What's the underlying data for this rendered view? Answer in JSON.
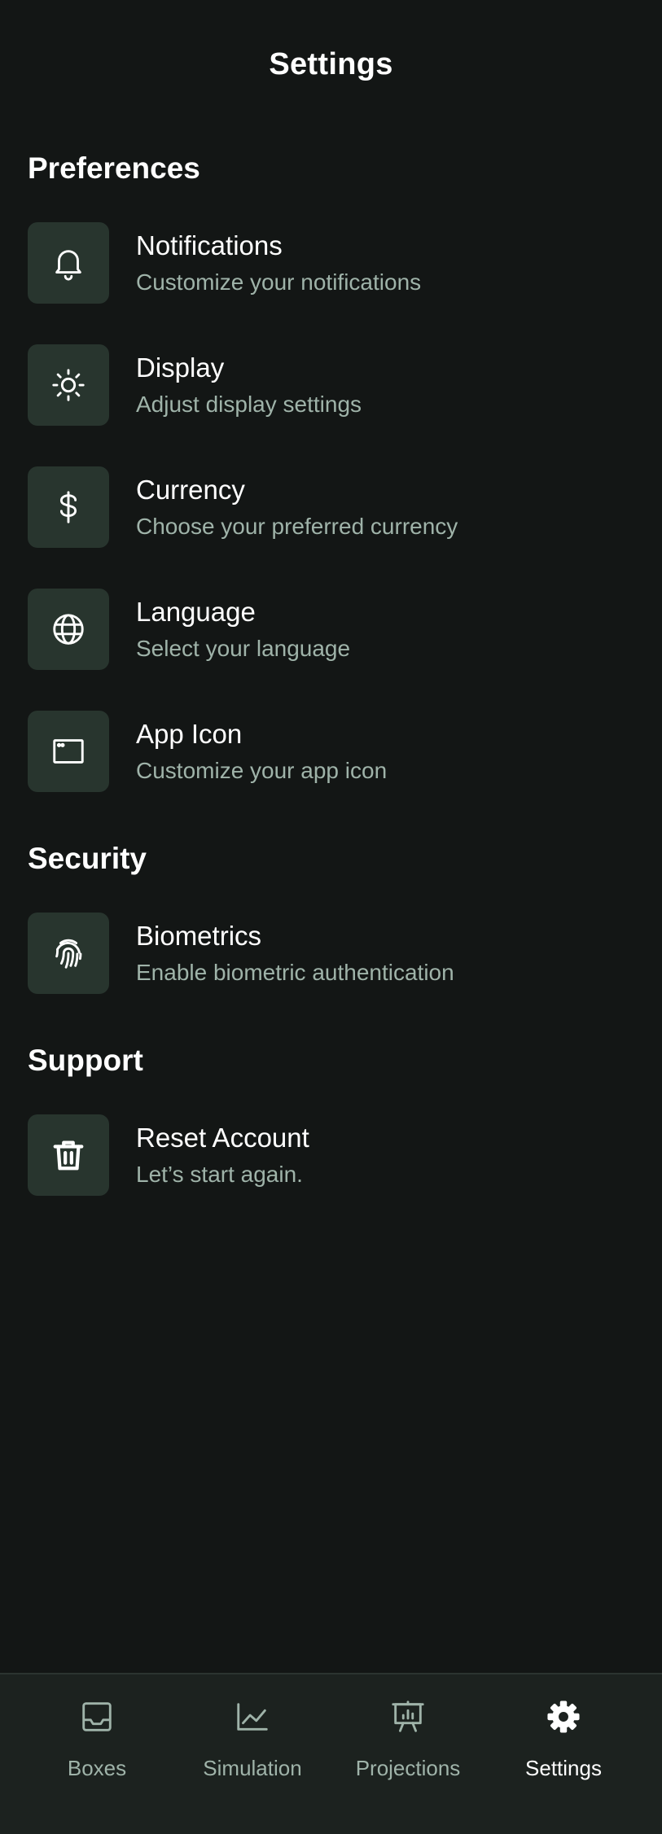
{
  "header": {
    "title": "Settings"
  },
  "sections": {
    "preferences": {
      "title": "Preferences",
      "items": [
        {
          "title": "Notifications",
          "subtitle": "Customize your notifications",
          "icon": "bell-icon"
        },
        {
          "title": "Display",
          "subtitle": "Adjust display settings",
          "icon": "sun-icon"
        },
        {
          "title": "Currency",
          "subtitle": "Choose your preferred currency",
          "icon": "dollar-icon"
        },
        {
          "title": "Language",
          "subtitle": "Select your language",
          "icon": "globe-icon"
        },
        {
          "title": "App Icon",
          "subtitle": "Customize your app icon",
          "icon": "app-window-icon"
        }
      ]
    },
    "security": {
      "title": "Security",
      "items": [
        {
          "title": "Biometrics",
          "subtitle": "Enable biometric authentication",
          "icon": "fingerprint-icon"
        }
      ]
    },
    "support": {
      "title": "Support",
      "items": [
        {
          "title": "Reset Account",
          "subtitle": "Let’s start again.",
          "icon": "trash-icon"
        }
      ]
    }
  },
  "tabbar": {
    "active": "Settings",
    "tabs": [
      {
        "label": "Boxes",
        "icon": "inbox-icon"
      },
      {
        "label": "Simulation",
        "icon": "line-chart-icon"
      },
      {
        "label": "Projections",
        "icon": "presentation-chart-icon"
      },
      {
        "label": "Settings",
        "icon": "gear-icon"
      }
    ]
  },
  "colors": {
    "background": "#131615",
    "icon_box": "#28352e",
    "subtitle": "#9fb3a9",
    "tabbar_background": "#1c221f",
    "active_tab": "#ffffff"
  }
}
